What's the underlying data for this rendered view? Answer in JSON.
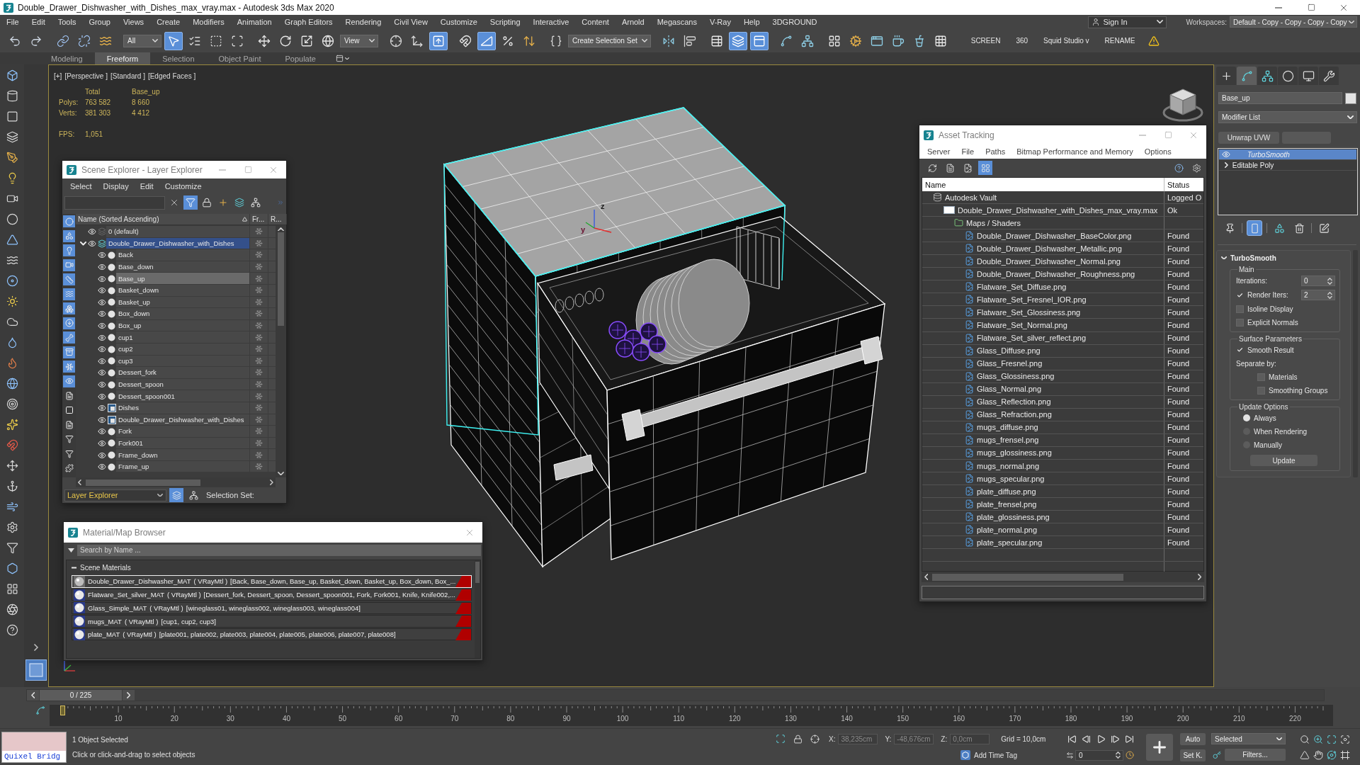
{
  "window": {
    "title": "Double_Drawer_Dishwasher_with_Dishes_max_vray.max - Autodesk 3ds Max 2020"
  },
  "menu_bar": {
    "items": [
      "File",
      "Edit",
      "Tools",
      "Group",
      "Views",
      "Create",
      "Modifiers",
      "Animation",
      "Graph Editors",
      "Rendering",
      "Civil View",
      "Customize",
      "Scripting",
      "Interactive",
      "Content",
      "Arnold",
      "Megascans",
      "V-Ray",
      "Help",
      "3DGROUND"
    ],
    "sign_in": "Sign In",
    "workspaces_label": "Workspaces:",
    "workspace": "Default - Copy - Copy - Copy - Copy"
  },
  "main_toolbar": [
    {
      "kind": "button",
      "active": false
    },
    {
      "kind": "button",
      "active": false
    },
    {
      "kind": "button",
      "active": false
    },
    {
      "kind": "button",
      "active": false
    },
    {
      "kind": "button",
      "active": false
    },
    {
      "kind": "dropdown",
      "value": "All"
    },
    {
      "kind": "button",
      "active": true
    },
    {
      "kind": "button",
      "active": false
    },
    {
      "kind": "button",
      "active": false
    },
    {
      "kind": "button",
      "active": false
    },
    {
      "kind": "button",
      "active": false
    },
    {
      "kind": "button",
      "active": false
    },
    {
      "kind": "button",
      "active": false
    },
    {
      "kind": "button",
      "active": false
    },
    {
      "kind": "dropdown",
      "value": "View"
    },
    {
      "kind": "button",
      "active": false
    },
    {
      "kind": "button",
      "active": false
    },
    {
      "kind": "button",
      "active": true
    },
    {
      "kind": "button",
      "active": false
    },
    {
      "kind": "button",
      "active": true
    },
    {
      "kind": "button",
      "active": false
    },
    {
      "kind": "button",
      "active": false
    },
    {
      "kind": "button",
      "active": false
    },
    {
      "kind": "dropdown",
      "value": "Create Selection Set"
    },
    {
      "kind": "button",
      "active": false
    },
    {
      "kind": "button",
      "active": false
    },
    {
      "kind": "button",
      "active": false
    },
    {
      "kind": "button",
      "active": true
    },
    {
      "kind": "button",
      "active": true
    },
    {
      "kind": "button",
      "active": false
    },
    {
      "kind": "button",
      "active": false
    },
    {
      "kind": "button",
      "active": false
    },
    {
      "kind": "button",
      "active": false
    },
    {
      "kind": "button",
      "active": false
    },
    {
      "kind": "button",
      "active": false
    },
    {
      "kind": "button",
      "active": false
    },
    {
      "kind": "button",
      "active": false
    },
    {
      "kind": "label",
      "text": "SCREEN"
    },
    {
      "kind": "label",
      "text": "360"
    },
    {
      "kind": "label",
      "text": "Squid Studio v"
    },
    {
      "kind": "label",
      "text": "RENAME"
    },
    {
      "kind": "warning"
    }
  ],
  "ribbon_tabs": [
    {
      "label": "Modeling",
      "selected": false
    },
    {
      "label": "Freeform",
      "selected": true
    },
    {
      "label": "Selection",
      "selected": false
    },
    {
      "label": "Object Paint",
      "selected": false
    },
    {
      "label": "Populate",
      "selected": false
    }
  ],
  "viewport": {
    "labels": [
      "[+]",
      "[Perspective ]",
      "[Standard ]",
      "[Edged Faces ]"
    ],
    "stats": {
      "columns": [
        "Total",
        "Base_up"
      ],
      "rows": [
        {
          "label": "Polys:",
          "values": [
            "763 582",
            "8 660"
          ]
        },
        {
          "label": "Verts:",
          "values": [
            "381 303",
            "4 412"
          ]
        }
      ]
    },
    "fps_label": "FPS:",
    "fps": "1,051",
    "gizmo_labels": [
      "z",
      "y"
    ]
  },
  "scene_explorer": {
    "title": "Scene Explorer - Layer Explorer",
    "menu": [
      "Select",
      "Display",
      "Edit",
      "Customize"
    ],
    "tool_buttons": [
      {
        "active": false
      },
      {
        "active": true
      },
      {
        "active": false
      },
      {
        "active": false
      },
      {
        "active": false
      },
      {
        "active": false
      }
    ],
    "filters": [
      {
        "active": true
      },
      {
        "active": true
      },
      {
        "active": true
      },
      {
        "active": true
      },
      {
        "active": true
      },
      {
        "active": true
      },
      {
        "active": true
      },
      {
        "active": true
      },
      {
        "active": true
      },
      {
        "active": true
      },
      {
        "active": true
      },
      {
        "active": true
      },
      {
        "active": false
      },
      {
        "active": false
      },
      {
        "active": false
      },
      {
        "active": false
      },
      {
        "active": false
      },
      {
        "active": false
      }
    ],
    "columns": [
      "Name (Sorted Ascending)",
      "Fr...",
      "R..."
    ],
    "tree": [
      {
        "kind": "layer",
        "name": "0 (default)",
        "visible": true,
        "current": false,
        "selected": false
      },
      {
        "kind": "layer",
        "name": "Double_Drawer_Dishwasher_with_Dishes",
        "visible": true,
        "current": true,
        "selected": false,
        "expanded": true,
        "children": [
          {
            "kind": "object",
            "name": "Back",
            "visible": true,
            "selected": false
          },
          {
            "kind": "object",
            "name": "Base_down",
            "visible": true,
            "selected": false
          },
          {
            "kind": "object",
            "name": "Base_up",
            "visible": true,
            "selected": true
          },
          {
            "kind": "object",
            "name": "Basket_down",
            "visible": true,
            "selected": false
          },
          {
            "kind": "object",
            "name": "Basket_up",
            "visible": true,
            "selected": false
          },
          {
            "kind": "object",
            "name": "Box_down",
            "visible": true,
            "selected": false
          },
          {
            "kind": "object",
            "name": "Box_up",
            "visible": true,
            "selected": false
          },
          {
            "kind": "object",
            "name": "cup1",
            "visible": true,
            "selected": false
          },
          {
            "kind": "object",
            "name": "cup2",
            "visible": true,
            "selected": false
          },
          {
            "kind": "object",
            "name": "cup3",
            "visible": true,
            "selected": false
          },
          {
            "kind": "object",
            "name": "Dessert_fork",
            "visible": true,
            "selected": false
          },
          {
            "kind": "object",
            "name": "Dessert_spoon",
            "visible": true,
            "selected": false
          },
          {
            "kind": "object",
            "name": "Dessert_spoon001",
            "visible": true,
            "selected": false
          },
          {
            "kind": "group",
            "name": "Dishes",
            "visible": true,
            "selected": false
          },
          {
            "kind": "group",
            "name": "Double_Drawer_Dishwasher_with_Dishes",
            "visible": true,
            "selected": false
          },
          {
            "kind": "object",
            "name": "Fork",
            "visible": true,
            "selected": false
          },
          {
            "kind": "object",
            "name": "Fork001",
            "visible": true,
            "selected": false
          },
          {
            "kind": "object",
            "name": "Frame_down",
            "visible": true,
            "selected": false
          },
          {
            "kind": "object",
            "name": "Frame_up",
            "visible": true,
            "selected": false
          }
        ]
      }
    ],
    "explorer_mode": "Layer Explorer",
    "bottom_buttons": [
      {
        "active": true
      },
      {
        "active": false
      }
    ],
    "selection_set_label": "Selection Set:"
  },
  "material_browser": {
    "title": "Material/Map Browser",
    "search": {
      "placeholder": "Search by Name ..."
    },
    "group": {
      "title": "Scene Materials",
      "expanded": true,
      "items": [
        {
          "name": "Double_Drawer_Dishwasher_MAT",
          "type": "( VRayMtl )",
          "objects": "[Back, Base_down, Base_up, Basket_down, Basket_up, Box_down, Box_...",
          "selected": true
        },
        {
          "name": "Flatware_Set_silver_MAT",
          "type": "( VRayMtl )",
          "objects": "[Dessert_fork, Dessert_spoon, Dessert_spoon001, Fork, Fork001, Knife, Knife002,...",
          "selected": false
        },
        {
          "name": "Glass_Simple_MAT",
          "type": "( VRayMtl )",
          "objects": "[wineglass01, wineglass002, wineglass003, wineglass004]",
          "selected": false
        },
        {
          "name": "mugs_MAT",
          "type": "( VRayMtl )",
          "objects": "[cup1, cup2, cup3]",
          "selected": false
        },
        {
          "name": "plate_MAT",
          "type": "( VRayMtl )",
          "objects": "[plate001, plate002, plate003, plate004, plate005, plate006, plate007, plate008]",
          "selected": false
        }
      ]
    }
  },
  "asset_tracking": {
    "title": "Asset Tracking",
    "menu": [
      "Server",
      "File",
      "Paths",
      "Bitmap Performance and Memory",
      "Options"
    ],
    "tool_buttons": [
      {
        "active": false
      },
      {
        "active": false
      },
      {
        "active": false
      },
      {
        "active": true
      }
    ],
    "columns": [
      "Name",
      "Status"
    ],
    "tree": [
      {
        "kind": "vault",
        "name": "Autodesk Vault",
        "status": "Logged O",
        "children": [
          {
            "kind": "scene",
            "name": "Double_Drawer_Dishwasher_with_Dishes_max_vray.max",
            "status": "Ok",
            "children": [
              {
                "kind": "folder",
                "name": "Maps / Shaders",
                "children": [
                  {
                    "kind": "bitmap",
                    "name": "Double_Drawer_Dishwasher_BaseColor.png",
                    "status": "Found"
                  },
                  {
                    "kind": "bitmap",
                    "name": "Double_Drawer_Dishwasher_Metallic.png",
                    "status": "Found"
                  },
                  {
                    "kind": "bitmap",
                    "name": "Double_Drawer_Dishwasher_Normal.png",
                    "status": "Found"
                  },
                  {
                    "kind": "bitmap",
                    "name": "Double_Drawer_Dishwasher_Roughness.png",
                    "status": "Found"
                  },
                  {
                    "kind": "bitmap",
                    "name": "Flatware_Set_Diffuse.png",
                    "status": "Found"
                  },
                  {
                    "kind": "bitmap",
                    "name": "Flatware_Set_Fresnel_IOR.png",
                    "status": "Found"
                  },
                  {
                    "kind": "bitmap",
                    "name": "Flatware_Set_Glossiness.png",
                    "status": "Found"
                  },
                  {
                    "kind": "bitmap",
                    "name": "Flatware_Set_Normal.png",
                    "status": "Found"
                  },
                  {
                    "kind": "bitmap",
                    "name": "Flatware_Set_silver_reflect.png",
                    "status": "Found"
                  },
                  {
                    "kind": "bitmap",
                    "name": "Glass_Diffuse.png",
                    "status": "Found"
                  },
                  {
                    "kind": "bitmap",
                    "name": "Glass_Fresnel.png",
                    "status": "Found"
                  },
                  {
                    "kind": "bitmap",
                    "name": "Glass_Glossiness.png",
                    "status": "Found"
                  },
                  {
                    "kind": "bitmap",
                    "name": "Glass_Normal.png",
                    "status": "Found"
                  },
                  {
                    "kind": "bitmap",
                    "name": "Glass_Reflection.png",
                    "status": "Found"
                  },
                  {
                    "kind": "bitmap",
                    "name": "Glass_Refraction.png",
                    "status": "Found"
                  },
                  {
                    "kind": "bitmap",
                    "name": "mugs_diffuse.png",
                    "status": "Found"
                  },
                  {
                    "kind": "bitmap",
                    "name": "mugs_frensel.png",
                    "status": "Found"
                  },
                  {
                    "kind": "bitmap",
                    "name": "mugs_glossiness.png",
                    "status": "Found"
                  },
                  {
                    "kind": "bitmap",
                    "name": "mugs_normal.png",
                    "status": "Found"
                  },
                  {
                    "kind": "bitmap",
                    "name": "mugs_specular.png",
                    "status": "Found"
                  },
                  {
                    "kind": "bitmap",
                    "name": "plate_diffuse.png",
                    "status": "Found"
                  },
                  {
                    "kind": "bitmap",
                    "name": "plate_frensel.png",
                    "status": "Found"
                  },
                  {
                    "kind": "bitmap",
                    "name": "plate_glossiness.png",
                    "status": "Found"
                  },
                  {
                    "kind": "bitmap",
                    "name": "plate_normal.png",
                    "status": "Found"
                  },
                  {
                    "kind": "bitmap",
                    "name": "plate_specular.png",
                    "status": "Found"
                  }
                ]
              }
            ]
          }
        ]
      }
    ]
  },
  "command_panel": {
    "tabs": [
      {
        "selected": false
      },
      {
        "selected": true
      },
      {
        "selected": false
      },
      {
        "selected": false
      },
      {
        "selected": false
      },
      {
        "selected": false
      }
    ],
    "object_name": "Base_up",
    "modifier_list": "Modifier List",
    "modifier_buttons": [
      "Unwrap UVW"
    ],
    "stack": [
      {
        "kind": "modifier",
        "name": "TurboSmooth",
        "enabled": true,
        "selected": true
      },
      {
        "kind": "base",
        "name": "Editable Poly",
        "expanded": false,
        "selected": false
      }
    ],
    "stack_tools": [
      {
        "active": false
      },
      {
        "active": true
      },
      {
        "active": false
      },
      {
        "active": false
      },
      {
        "active": false
      }
    ],
    "rollout": {
      "title": "TurboSmooth",
      "expanded": true,
      "groups": [
        {
          "title": "Main",
          "controls": [
            {
              "kind": "spinner",
              "label": "Iterations:",
              "value": "0"
            },
            {
              "kind": "check_spinner",
              "label": "Render Iters:",
              "checked": true,
              "value": "2"
            },
            {
              "kind": "checkbox",
              "label": "Isoline Display",
              "checked": false
            },
            {
              "kind": "checkbox",
              "label": "Explicit Normals",
              "checked": false
            }
          ]
        },
        {
          "title": "Surface Parameters",
          "controls": [
            {
              "kind": "checkbox",
              "label": "Smooth Result",
              "checked": true
            },
            {
              "kind": "label",
              "label": "Separate by:",
              "children": [
                {
                  "kind": "checkbox",
                  "label": "Materials",
                  "checked": false
                },
                {
                  "kind": "checkbox",
                  "label": "Smoothing Groups",
                  "checked": false
                }
              ]
            }
          ]
        },
        {
          "title": "Update Options",
          "controls": [
            {
              "kind": "radio",
              "label": "Always",
              "selected": true
            },
            {
              "kind": "radio",
              "label": "When Rendering",
              "selected": false
            },
            {
              "kind": "radio",
              "label": "Manually",
              "selected": false
            },
            {
              "kind": "button",
              "label": "Update"
            }
          ]
        }
      ]
    }
  },
  "time_slider": {
    "position": "0 / 225",
    "level": 0
  },
  "track_bar": {
    "labels": [
      "10",
      "20",
      "30",
      "40",
      "50",
      "60",
      "70",
      "80",
      "90",
      "100",
      "110",
      "120",
      "130",
      "140",
      "150",
      "160",
      "170",
      "180",
      "190",
      "200",
      "210",
      "220"
    ]
  },
  "status_bar": {
    "quixel_bridge": "Quixel Bridg",
    "selection": "1 Object Selected",
    "prompt": "Click or click-and-drag to select objects",
    "coordinates": [
      {
        "axis": "X:",
        "value": "38,235cm",
        "disabled": true
      },
      {
        "axis": "Y:",
        "value": "-48,676cm",
        "disabled": true
      },
      {
        "axis": "Z:",
        "value": "0,0cm",
        "disabled": true
      }
    ],
    "grid": "Grid = 10,0cm",
    "time_tag": "Add Time Tag",
    "current_frame": "0",
    "auto_key": {
      "label": "Auto",
      "on": false
    },
    "set_key": "Set K.",
    "key_filter": "Selected",
    "filters": "Filters..."
  }
}
